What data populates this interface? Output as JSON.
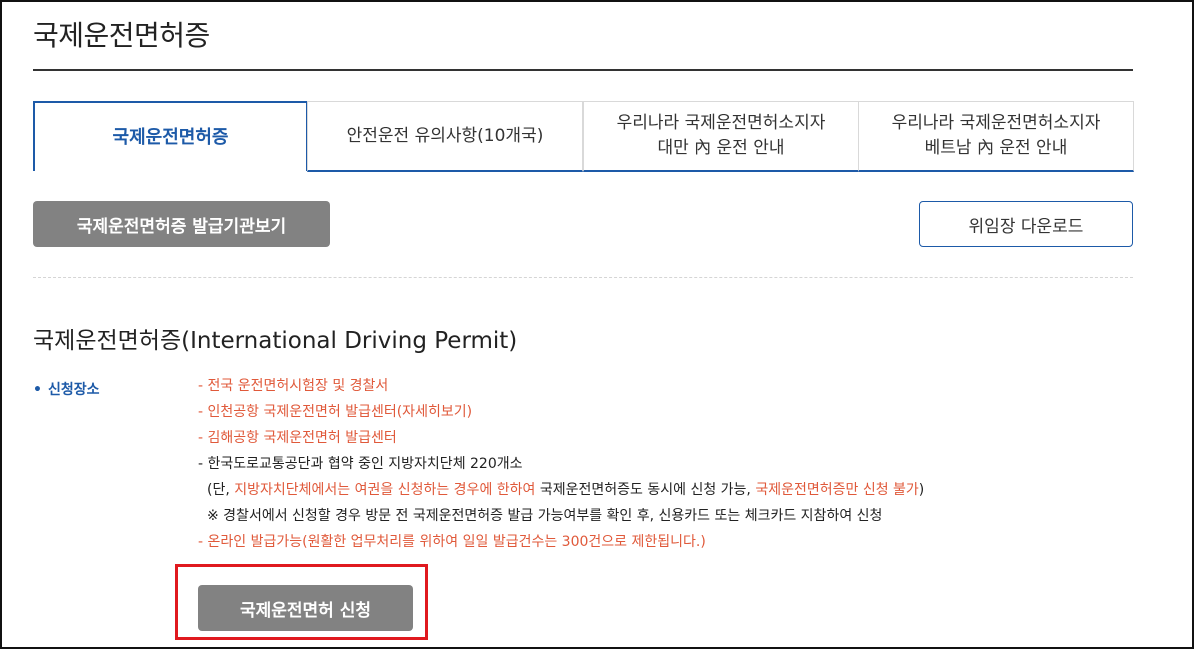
{
  "page": {
    "title": "국제운전면허증"
  },
  "tabs": [
    {
      "line1": "국제운전면허증",
      "line2": ""
    },
    {
      "line1": "안전운전 유의사항(10개국)",
      "line2": ""
    },
    {
      "line1": "우리나라 국제운전면허소지자",
      "line2": "대만 內 운전 안내"
    },
    {
      "line1": "우리나라 국제운전면허소지자",
      "line2": "베트남 內 운전 안내"
    }
  ],
  "buttons": {
    "issuer_view": "국제운전면허증 발급기관보기",
    "download": "위임장 다운로드",
    "apply": "국제운전면허 신청"
  },
  "section": {
    "title": "국제운전면허증(International Driving Permit)",
    "bullet_label": "신청장소",
    "items": {
      "l1": "- 전국 운전면허시험장 및 경찰서",
      "l2": "- 인천공항 국제운전면허 발급센터(자세히보기)",
      "l3": "- 김해공항 국제운전면허 발급센터",
      "l4": "- 한국도로교통공단과 협약 중인 지방자치단체 220개소",
      "l5_a": "(단, ",
      "l5_b": "지방자치단체에서는 여권을 신청하는 경우에 한하여",
      "l5_c": " 국제운전면허증도 동시에 신청 가능, ",
      "l5_d": "국제운전면허증만 신청 불가",
      "l5_e": ")",
      "l6": "※ 경찰서에서 신청할 경우 방문 전 국제운전면허증 발급 가능여부를 확인 후, 신용카드 또는 체크카드 지참하여 신청",
      "l7": "- 온라인 발급가능(원활한 업무처리를 위하여 일일 발급건수는 300건으로 제한됩니다.)"
    }
  },
  "colors": {
    "accent": "#1d5aa8",
    "warning": "#e0593a",
    "button_gray": "#828282",
    "highlight": "#e0191f"
  }
}
